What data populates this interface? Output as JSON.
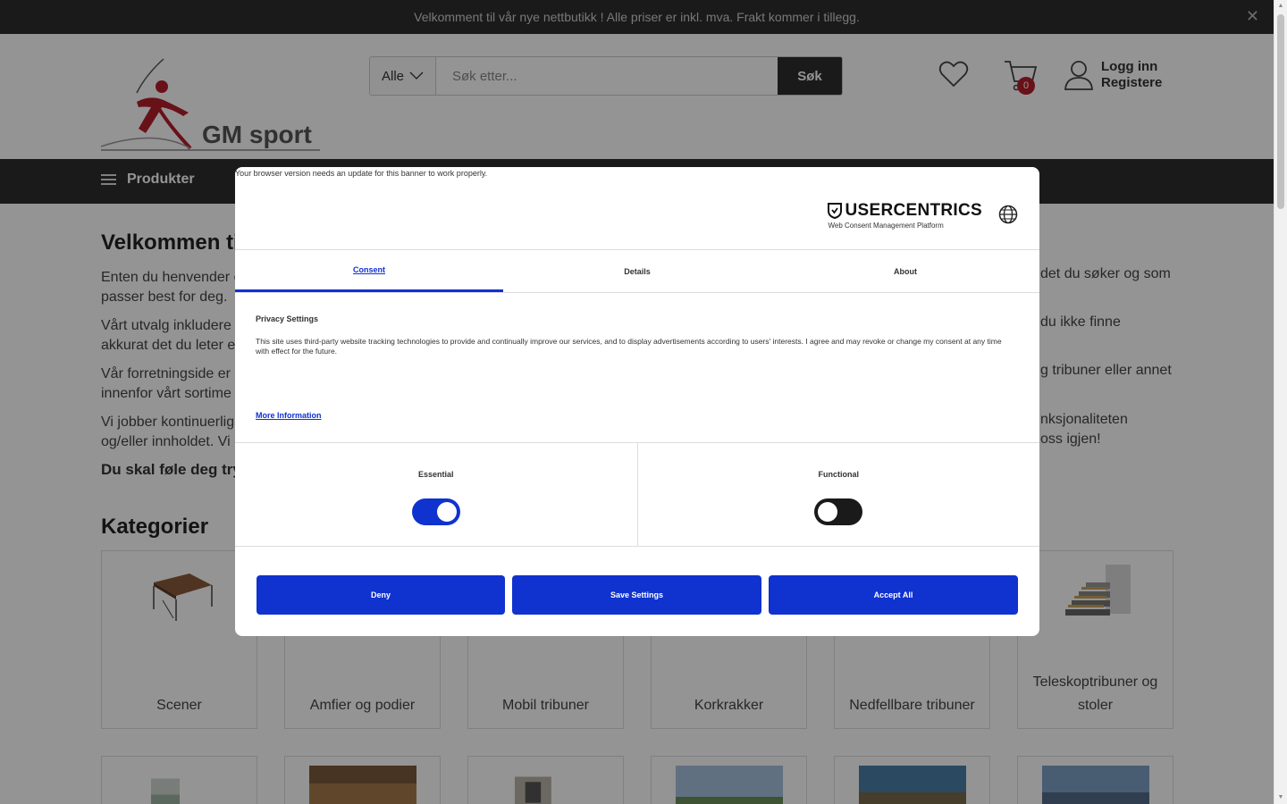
{
  "announcement": {
    "text": "Velkomment til vår nye nettbutikk ! Alle priser er inkl. mva. Frakt kommer i tillegg.",
    "close": "✕"
  },
  "header": {
    "logo_text": "GM sport",
    "search_category": "Alle",
    "search_placeholder": "Søk etter...",
    "search_button": "Søk",
    "cart_count": "0",
    "login": "Logg inn",
    "register": "Registere"
  },
  "nav": {
    "products": "Produkter"
  },
  "main": {
    "title": "Velkommen ti",
    "paragraphs": [
      "Enten du henvender o",
      "passer best for deg. ",
      "Vårt utvalg inkludere",
      "akkurat det du leter e",
      "Vår forretningside er",
      "innenfor vårt sortime",
      "Vi jobber kontinuerlig",
      "og/eller innholdet. Vi"
    ],
    "paragraphs_right": [
      "det du søker og som",
      "du ikke finne",
      "g tribuner eller annet",
      "nksjonaliteten",
      "oss igjen!"
    ],
    "strong": "Du skal føle deg try"
  },
  "categories": {
    "title": "Kategorier",
    "items": [
      "Scener",
      "Amfier og podier",
      "Mobil tribuner",
      "Korkrakker",
      "Nedfellbare tribuner",
      "Teleskoptribuner og stoler"
    ]
  },
  "consent": {
    "browser_note": "Your browser version needs an update for this banner to work properly.",
    "brand": "USERCENTRICS",
    "brand_sub": "Web Consent Management Platform",
    "tabs": [
      "Consent",
      "Details",
      "About"
    ],
    "privacy_title": "Privacy Settings",
    "privacy_text": "This site uses third-party website tracking technologies to provide and continually improve our services, and to display advertisements according to users' interests. I agree and may revoke or change my consent at any time with effect for the future.",
    "more_info": "More Information",
    "essential_label": "Essential",
    "essential_on": true,
    "functional_label": "Functional",
    "functional_on": false,
    "deny": "Deny",
    "save": "Save Settings",
    "accept": "Accept All"
  },
  "colors": {
    "dark_bar": "#2d2d2d",
    "consent_blue": "#1032cf",
    "badge_red": "#b51e2a"
  }
}
